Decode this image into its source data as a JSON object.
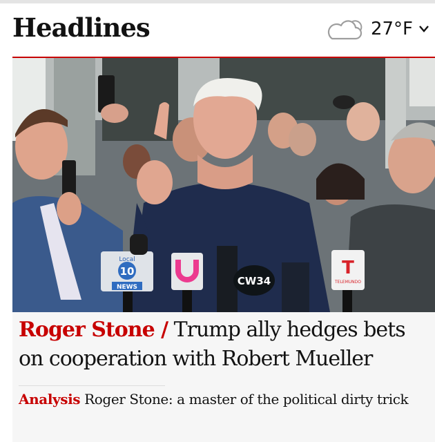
{
  "header": {
    "title": "Headlines",
    "weather": {
      "temperature": "27°F",
      "icon": "cloud-sun-icon"
    }
  },
  "lead_story": {
    "kicker": "Roger Stone /",
    "headline": " Trump ally hedges bets on cooperation with Robert Mueller",
    "photo_icon": "press-conference-photo",
    "microphone_flags": [
      {
        "line1": "Local",
        "line2": "10",
        "line3": "NEWS"
      },
      {
        "label": "CW34"
      },
      {
        "letter": "T",
        "label": "TELEMUNDO"
      }
    ]
  },
  "related": {
    "kicker": "Analysis",
    "text": " Roger Stone: a master of the political dirty trick"
  },
  "colors": {
    "accent": "#c70000",
    "card_bg": "#f6f6f6"
  }
}
